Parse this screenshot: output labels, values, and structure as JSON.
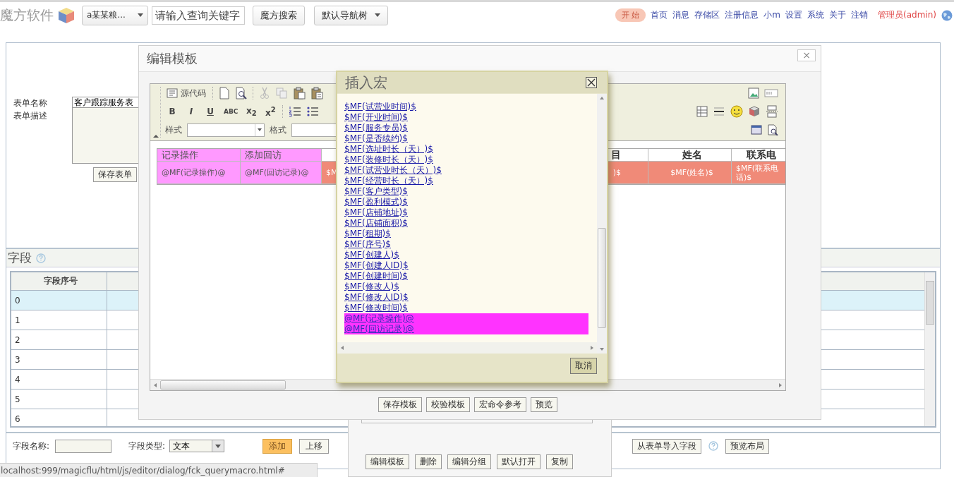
{
  "topbar": {
    "logo": "魔方软件",
    "scope_select": "a某某粮...",
    "search": {
      "placeholder": "请输入查询关键字"
    },
    "search_button": "魔方搜索",
    "nav_button": "默认导航树",
    "start_button": "开 始",
    "links": [
      "首页",
      "消息",
      "存储区",
      "注册信息",
      "小m",
      "设置",
      "系统",
      "关于",
      "注销"
    ],
    "user": "管理员(admin)"
  },
  "form": {
    "name_label": "表单名称",
    "name_value": "客户跟踪服务表",
    "desc_label": "表单描述",
    "save_button": "保存表单"
  },
  "fields": {
    "title": "字段",
    "column": "字段序号",
    "rows": [
      {
        "index": "0",
        "selected": true
      },
      {
        "index": "1",
        "selected": false
      },
      {
        "index": "2",
        "selected": false
      },
      {
        "index": "3",
        "selected": false
      },
      {
        "index": "4",
        "selected": false
      },
      {
        "index": "5",
        "selected": false
      },
      {
        "index": "6",
        "selected": false
      }
    ],
    "name_label": "字段名称:",
    "type_label": "字段类型:",
    "type_value": "文本",
    "buttons": [
      {
        "label": "添加",
        "kind": "primary"
      },
      {
        "label": "上移",
        "kind": "plain"
      }
    ],
    "import_button": "从表单导入字段",
    "preview_button": "预览布局"
  },
  "template_panel": {
    "buttons": [
      "编辑模板",
      "删除",
      "编辑分组",
      "默认打开",
      "复制"
    ]
  },
  "editor_dialog": {
    "title": "编辑模板",
    "close": "×",
    "source_button": "源代码",
    "format_buttons": [
      "B",
      "I",
      "U",
      "ABC",
      "x$_{2}$",
      "x$^{2}$"
    ],
    "style_label": "样式",
    "format_label": "格式",
    "table": [
      {
        "header": "记录操作",
        "value": "@MF(记录操作)@",
        "kind": "action"
      },
      {
        "header": "添加回访",
        "value": "@MF(回访记录)@",
        "kind": "action"
      },
      {
        "value": "$M",
        "kind": "field"
      },
      {
        "header": "目",
        "value": ")$",
        "kind": "field"
      },
      {
        "header": "姓名",
        "value": "$MF(姓名)$",
        "kind": "field"
      },
      {
        "header": "联系电",
        "value": "$MF(联系电话)$",
        "kind": "field"
      }
    ],
    "buttons": [
      "保存模板",
      "校验模板",
      "宏命令参考",
      "预览"
    ]
  },
  "macro_dialog": {
    "title": "插入宏",
    "items": [
      {
        "text": "$MF(试营业时间)$",
        "selected": false
      },
      {
        "text": "$MF(开业时间)$",
        "selected": false
      },
      {
        "text": "$MF(服务专员)$",
        "selected": false
      },
      {
        "text": "$MF(是否续约)$",
        "selected": false
      },
      {
        "text": "$MF(选址时长（天）)$",
        "selected": false
      },
      {
        "text": "$MF(装修时长（天）)$",
        "selected": false
      },
      {
        "text": "$MF(试营业时长（天）)$",
        "selected": false
      },
      {
        "text": "$MF(经营时长（天）)$",
        "selected": false
      },
      {
        "text": "$MF(客户类型)$",
        "selected": false
      },
      {
        "text": "$MF(盈利模式)$",
        "selected": false
      },
      {
        "text": "$MF(店铺地址)$",
        "selected": false
      },
      {
        "text": "$MF(店铺面积)$",
        "selected": false
      },
      {
        "text": "$MF(租期)$",
        "selected": false
      },
      {
        "text": "$MF(序号)$",
        "selected": false
      },
      {
        "text": "$MF(创建人)$",
        "selected": false
      },
      {
        "text": "$MF(创建人ID)$",
        "selected": false
      },
      {
        "text": "$MF(创建时间)$",
        "selected": false
      },
      {
        "text": "$MF(修改人)$",
        "selected": false
      },
      {
        "text": "$MF(修改人ID)$",
        "selected": false
      },
      {
        "text": "$MF(修改时间)$",
        "selected": false
      },
      {
        "text": "@MF(记录操作)@",
        "selected": true
      },
      {
        "text": "@MF(回访记录)@",
        "selected": true
      }
    ],
    "cancel": "取消"
  },
  "status_bar": "localhost:999/magicflu/html/js/editor/dialog/fck_querymacro.html#"
}
